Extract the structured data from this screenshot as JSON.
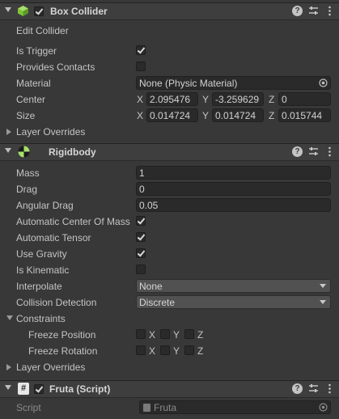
{
  "box_collider": {
    "title": "Box Collider",
    "enabled": true,
    "edit_collider_label": "Edit Collider",
    "is_trigger_label": "Is Trigger",
    "is_trigger": true,
    "provides_contacts_label": "Provides Contacts",
    "provides_contacts": false,
    "material_label": "Material",
    "material_value": "None (Physic Material)",
    "center_label": "Center",
    "center": {
      "x": "2.095476",
      "y": "-3.259629",
      "z": "0"
    },
    "size_label": "Size",
    "size": {
      "x": "0.014724",
      "y": "0.014724",
      "z": "0.015744"
    },
    "layer_overrides_label": "Layer Overrides"
  },
  "rigidbody": {
    "title": "Rigidbody",
    "mass_label": "Mass",
    "mass": "1",
    "drag_label": "Drag",
    "drag": "0",
    "angular_drag_label": "Angular Drag",
    "angular_drag": "0.05",
    "auto_com_label": "Automatic Center Of Mass",
    "auto_com": true,
    "auto_tensor_label": "Automatic Tensor",
    "auto_tensor": true,
    "use_gravity_label": "Use Gravity",
    "use_gravity": true,
    "is_kinematic_label": "Is Kinematic",
    "is_kinematic": false,
    "interpolate_label": "Interpolate",
    "interpolate": "None",
    "collision_detection_label": "Collision Detection",
    "collision_detection": "Discrete",
    "constraints_label": "Constraints",
    "freeze_position_label": "Freeze Position",
    "freeze_rotation_label": "Freeze Rotation",
    "axis_x": "X",
    "axis_y": "Y",
    "axis_z": "Z",
    "layer_overrides_label": "Layer Overrides"
  },
  "script": {
    "title": "Fruta (Script)",
    "enabled": true,
    "script_label": "Script",
    "script_value": "Fruta"
  },
  "icons": {
    "box": "cube-icon",
    "rigidbody": "rigidbody-icon",
    "script": "script-hash-icon",
    "help": "help-icon",
    "settings": "sliders-icon",
    "menu": "kebab-menu-icon"
  },
  "colors": {
    "panel": "#383838",
    "header": "#3e3e3e",
    "field": "#2a2a2a",
    "accent_green": "#7ec53b"
  }
}
